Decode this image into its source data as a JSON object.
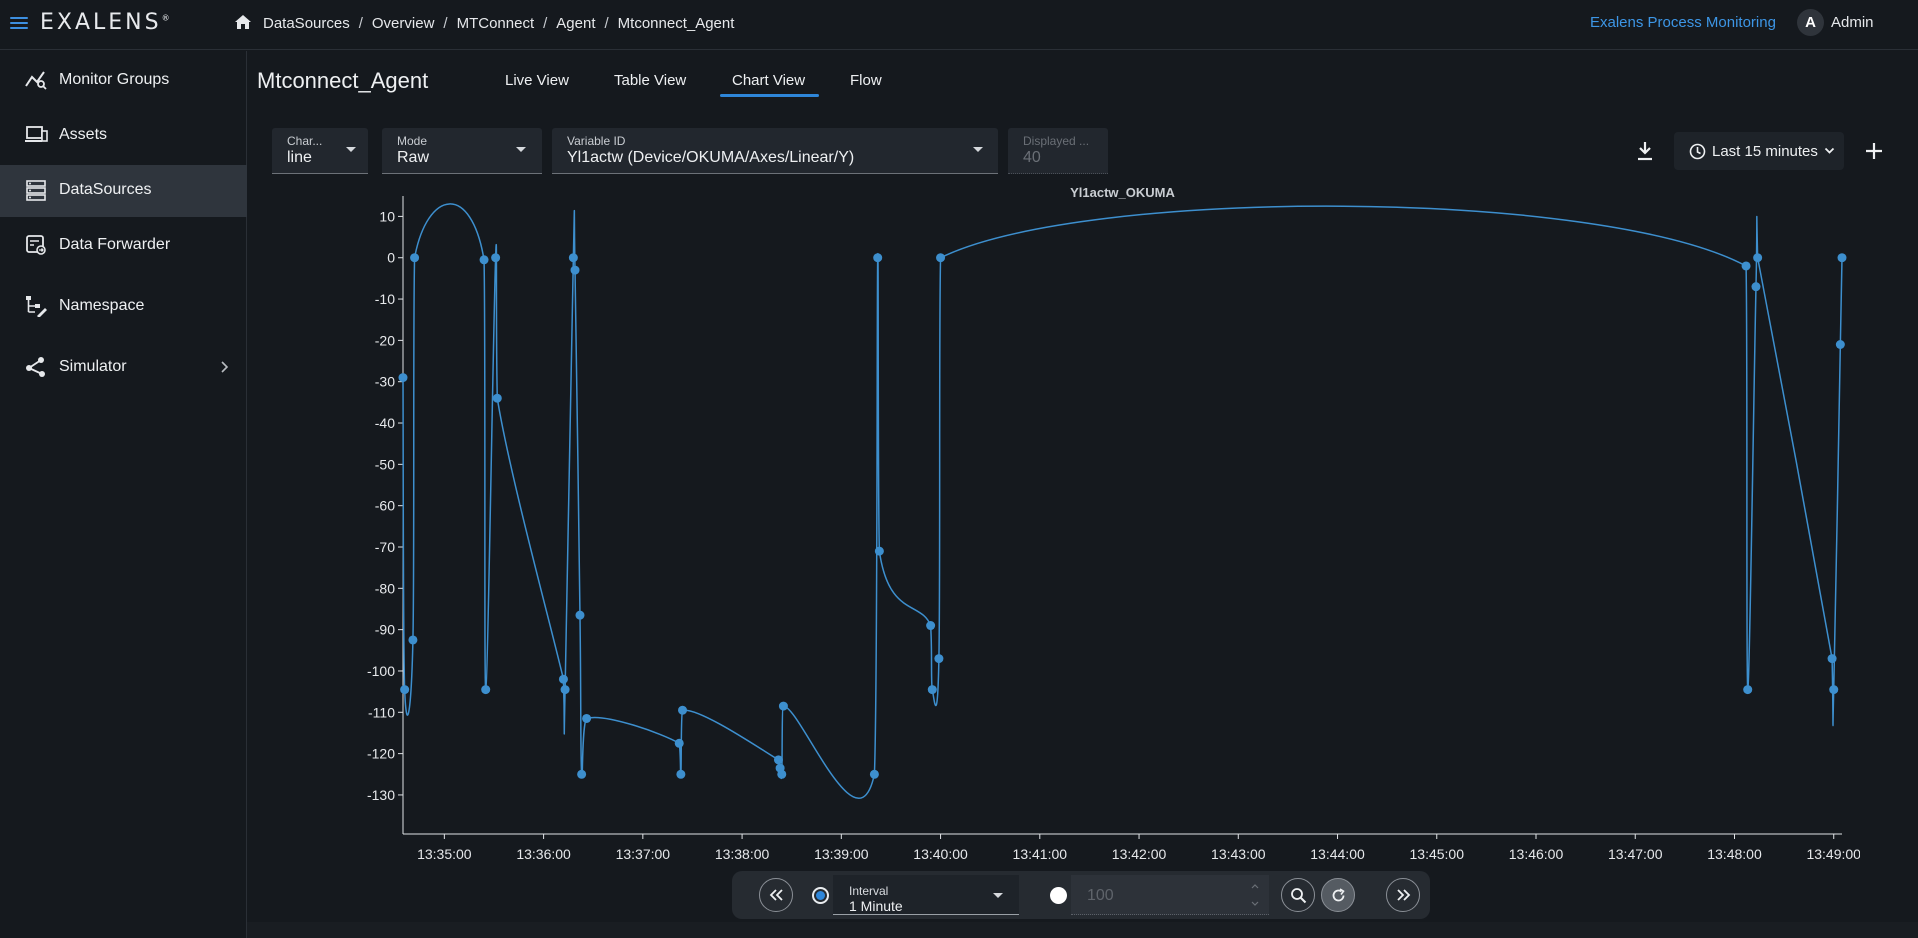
{
  "header": {
    "logo": "EXALENS",
    "logo_mark": "®",
    "breadcrumbs": [
      "DataSources",
      "Overview",
      "MTConnect",
      "Agent",
      "Mtconnect_Agent"
    ],
    "separator": "/",
    "app_link": "Exalens Process Monitoring",
    "avatar_letter": "A",
    "user_name": "Admin"
  },
  "sidebar": {
    "items": [
      {
        "label": "Monitor Groups",
        "icon": "monitor-groups-icon"
      },
      {
        "label": "Assets",
        "icon": "assets-icon"
      },
      {
        "label": "DataSources",
        "icon": "datasources-icon",
        "active": true
      },
      {
        "label": "Data Forwarder",
        "icon": "data-forwarder-icon"
      },
      {
        "label": "Namespace",
        "icon": "namespace-icon"
      },
      {
        "label": "Simulator",
        "icon": "simulator-icon",
        "has_submenu": true
      }
    ]
  },
  "main": {
    "title": "Mtconnect_Agent",
    "tabs": [
      {
        "label": "Live View"
      },
      {
        "label": "Table View"
      },
      {
        "label": "Chart View",
        "active": true
      },
      {
        "label": "Flow"
      }
    ],
    "controls": {
      "chart_type": {
        "label": "Char...",
        "value": "line"
      },
      "mode": {
        "label": "Mode",
        "value": "Raw"
      },
      "variable": {
        "label": "Variable ID",
        "value": "Yl1actw (Device/OKUMA/Axes/Linear/Y)"
      },
      "displayed": {
        "label": "Displayed ...",
        "value": "40"
      },
      "time_range": "Last 15 minutes"
    },
    "bottom_bar": {
      "interval_label": "Interval",
      "interval_value": "1 Minute",
      "count_value": "100",
      "interval_selected": true
    }
  },
  "colors": {
    "accent": "#2e86d9",
    "series": "#3d8fce",
    "background": "#15191e"
  },
  "chart_data": {
    "type": "line",
    "title": "Yl1actw_OKUMA",
    "xlabel": "",
    "ylabel": "",
    "ylim": [
      -138,
      13
    ],
    "y_ticks": [
      10,
      0,
      -10,
      -20,
      -30,
      -40,
      -50,
      -60,
      -70,
      -80,
      -90,
      -100,
      -110,
      -120,
      -130
    ],
    "x_ticks": [
      "13:35:00",
      "13:36:00",
      "13:37:00",
      "13:38:00",
      "13:39:00",
      "13:40:00",
      "13:41:00",
      "13:42:00",
      "13:43:00",
      "13:44:00",
      "13:45:00",
      "13:46:00",
      "13:47:00",
      "13:48:00",
      "13:49:00"
    ],
    "x_range": [
      "13:34:35",
      "13:49:05"
    ],
    "grid": false,
    "series": [
      {
        "points": [
          {
            "t": "13:34:35",
            "y": -29
          },
          {
            "t": "13:34:36",
            "y": -104.5
          },
          {
            "t": "13:34:41",
            "y": -92.5
          },
          {
            "t": "13:34:42",
            "y": 0
          },
          {
            "t": "13:35:24",
            "y": -0.5
          },
          {
            "t": "13:35:25",
            "y": -104.5
          },
          {
            "t": "13:35:31",
            "y": 0
          },
          {
            "t": "13:35:32",
            "y": -34
          },
          {
            "t": "13:36:12",
            "y": -102
          },
          {
            "t": "13:36:13",
            "y": -104.5
          },
          {
            "t": "13:36:18",
            "y": 0
          },
          {
            "t": "13:36:19",
            "y": -3
          },
          {
            "t": "13:36:22",
            "y": -86.5
          },
          {
            "t": "13:36:23",
            "y": -125
          },
          {
            "t": "13:36:26",
            "y": -111.5
          },
          {
            "t": "13:37:22",
            "y": -117.5
          },
          {
            "t": "13:37:23",
            "y": -125
          },
          {
            "t": "13:37:24",
            "y": -109.5
          },
          {
            "t": "13:38:22",
            "y": -121.5
          },
          {
            "t": "13:38:23",
            "y": -123.5
          },
          {
            "t": "13:38:24",
            "y": -125
          },
          {
            "t": "13:38:25",
            "y": -108.5
          },
          {
            "t": "13:39:20",
            "y": -125
          },
          {
            "t": "13:39:22",
            "y": 0
          },
          {
            "t": "13:39:23",
            "y": -71
          },
          {
            "t": "13:39:54",
            "y": -89
          },
          {
            "t": "13:39:55",
            "y": -104.5
          },
          {
            "t": "13:39:59",
            "y": -97
          },
          {
            "t": "13:40:00",
            "y": 0
          },
          {
            "t": "13:48:07",
            "y": -2
          },
          {
            "t": "13:48:08",
            "y": -104.5
          },
          {
            "t": "13:48:13",
            "y": -7
          },
          {
            "t": "13:48:14",
            "y": 0
          },
          {
            "t": "13:48:59",
            "y": -97
          },
          {
            "t": "13:49:00",
            "y": -104.5
          },
          {
            "t": "13:49:04",
            "y": -21
          },
          {
            "t": "13:49:05",
            "y": 0
          }
        ]
      }
    ]
  }
}
